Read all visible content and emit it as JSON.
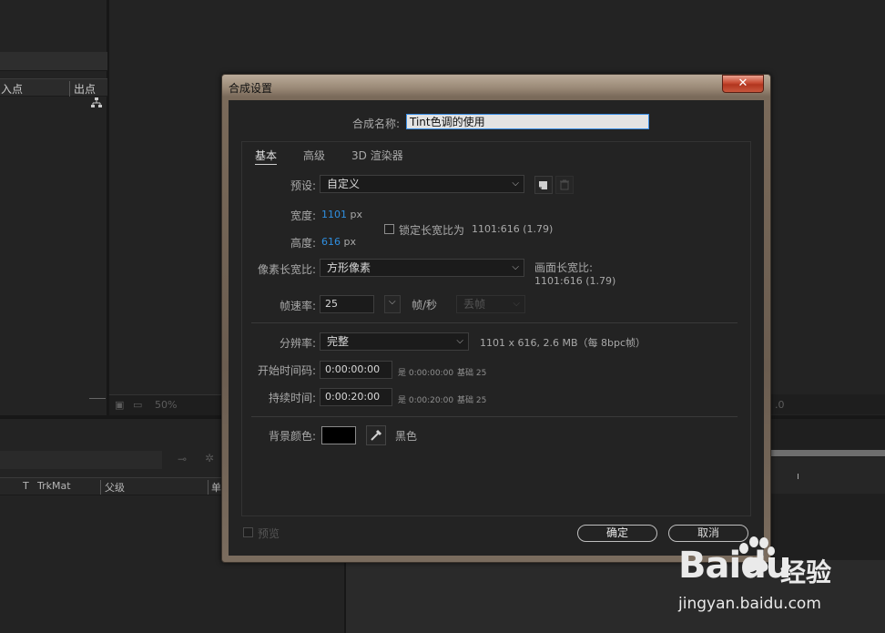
{
  "background": {
    "project_header": {
      "in_point": "入点",
      "out_point": "出点"
    },
    "timeline_header": {
      "t": "T",
      "trkmat": "TrkMat",
      "parent": "父级",
      "extra": "单"
    },
    "comp_zoom": "50%",
    "right_readout": ".0"
  },
  "dialog": {
    "title": "合成设置",
    "close_label": "✕",
    "name_label": "合成名称:",
    "name_value": "Tint色调的使用",
    "tabs": [
      "基本",
      "高级",
      "3D 渲染器"
    ],
    "preset": {
      "label": "预设:",
      "value": "自定义"
    },
    "width": {
      "label": "宽度:",
      "value": "1101",
      "unit": "px"
    },
    "height": {
      "label": "高度:",
      "value": "616",
      "unit": "px"
    },
    "lock_aspect": {
      "label": "锁定长宽比为",
      "value": "1101:616 (1.79)",
      "checked": false
    },
    "pixel_aspect": {
      "label": "像素长宽比:",
      "value": "方形像素"
    },
    "frame_aspect": {
      "label": "画面长宽比:",
      "value": "1101:616 (1.79)"
    },
    "frame_rate": {
      "label": "帧速率:",
      "value": "25",
      "unit": "帧/秒",
      "drop_frame": "丢帧"
    },
    "resolution": {
      "label": "分辨率:",
      "value": "完整",
      "info": "1101 x 616, 2.6 MB（每 8bpc帧）"
    },
    "start_timecode": {
      "label": "开始时间码:",
      "value": "0:00:00:00",
      "note": "是 0:00:00:00",
      "base": "基础 25"
    },
    "duration": {
      "label": "持续时间:",
      "value": "0:00:20:00",
      "note": "是 0:00:20:00",
      "base": "基础 25"
    },
    "bg_color": {
      "label": "背景颜色:",
      "name": "黑色",
      "color": "#000000"
    },
    "preview_label": "预览",
    "ok_label": "确定",
    "cancel_label": "取消"
  },
  "watermark": {
    "logo": "Baidu",
    "cn": "经验",
    "url": "jingyan.baidu.com"
  },
  "colors": {
    "accent_blue": "#2f8fe0",
    "input_focus": "#3a8ee6",
    "close_red": "#c74a32"
  }
}
